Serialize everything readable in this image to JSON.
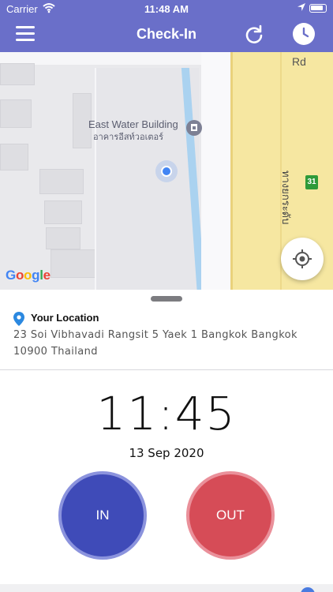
{
  "status_bar": {
    "carrier": "Carrier",
    "time": "11:48 AM"
  },
  "nav": {
    "title": "Check-In",
    "icons": [
      "menu-icon",
      "refresh-icon",
      "clock-icon"
    ]
  },
  "map": {
    "poi_name": "East Water Building",
    "poi_name_th": "อาคารอีสท์วอเตอร์",
    "road_label": "Rd",
    "road_label_th": "ทางยกระดับ",
    "route_number": "31",
    "attribution": "Google"
  },
  "location": {
    "title": "Your Location",
    "address": "23 Soi Vibhavadi Rangsit 5 Yaek 1 Bangkok Bangkok 10900 Thailand"
  },
  "checkin": {
    "time": "11:45",
    "date": "13 Sep 2020",
    "in_label": "IN",
    "out_label": "OUT"
  },
  "colors": {
    "header": "#6a6fc9",
    "in_button": "#3f4bb8",
    "out_button": "#d64c57"
  }
}
